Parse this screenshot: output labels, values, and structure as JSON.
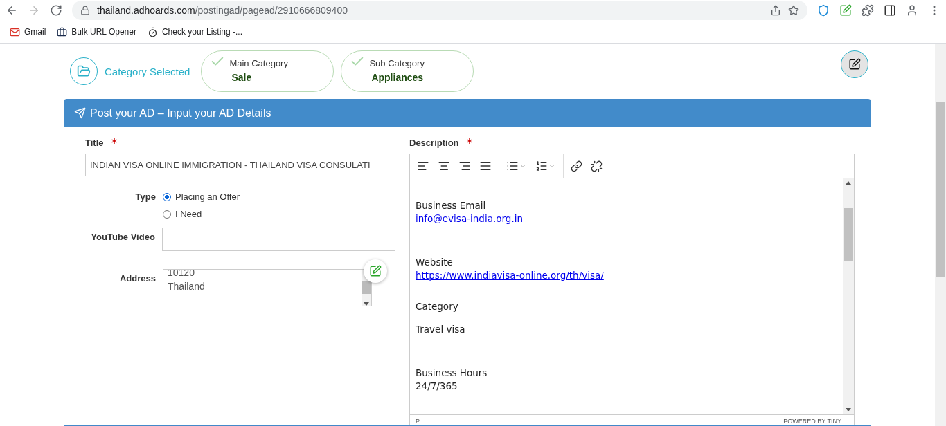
{
  "browser": {
    "url_host": "thailand.adhoards.com",
    "url_path": "/postingad/pagead/2910666809400",
    "bookmarks": [
      {
        "label": "Gmail",
        "kind": "mail"
      },
      {
        "label": "Bulk URL Opener",
        "kind": "briefcase"
      },
      {
        "label": "Check your Listing -...",
        "kind": "timer"
      }
    ]
  },
  "steps": {
    "label": "Category Selected",
    "items": [
      {
        "caption": "Main Category",
        "value": "Sale",
        "checked": true
      },
      {
        "caption": "Sub Category",
        "value": "Appliances",
        "checked": true
      }
    ]
  },
  "panel": {
    "title": "Post your AD – Input your AD Details"
  },
  "form": {
    "title": {
      "label": "Title",
      "required": true,
      "value": "INDIAN VISA ONLINE IMMIGRATION - THAILAND VISA CONSULATI"
    },
    "type": {
      "label": "Type",
      "options": [
        {
          "label": "Placing an Offer",
          "selected": true
        },
        {
          "label": "I Need",
          "selected": false
        }
      ]
    },
    "youtube": {
      "label": "YouTube Video"
    },
    "address": {
      "label": "Address",
      "lines": [
        "10120",
        "Thailand"
      ]
    },
    "description": {
      "label": "Description",
      "required": true,
      "blocks": [
        {
          "lines": [
            {
              "kind": "text",
              "text": "Business Email"
            },
            {
              "kind": "link",
              "text": "info@evisa-india.org.in"
            }
          ]
        },
        {
          "lines": [
            {
              "kind": "text",
              "text": "Website"
            },
            {
              "kind": "link",
              "text": "https://www.indiavisa-online.org/th/visa/"
            }
          ]
        },
        {
          "lines": [
            {
              "kind": "text",
              "text": "Category"
            }
          ]
        },
        {
          "lines": [
            {
              "kind": "text",
              "text": "Travel visa"
            }
          ]
        },
        {
          "lines": [
            {
              "kind": "text",
              "text": "Business Hours"
            },
            {
              "kind": "text",
              "text": "24/7/365"
            }
          ]
        }
      ],
      "status_path": "P",
      "brand": "POWERED BY TINY"
    }
  }
}
